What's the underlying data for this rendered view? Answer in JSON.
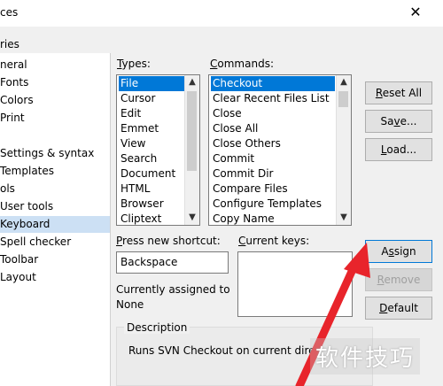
{
  "window": {
    "title": "ces",
    "close_glyph": "✕"
  },
  "categories": {
    "label": "ries",
    "items": [
      {
        "label": "neral"
      },
      {
        "label": "Fonts"
      },
      {
        "label": "Colors"
      },
      {
        "label": "Print"
      },
      {
        "label": ""
      },
      {
        "label": "Settings & syntax"
      },
      {
        "label": "Templates"
      },
      {
        "label": "ols"
      },
      {
        "label": "User tools"
      },
      {
        "label": "Keyboard",
        "selected": true
      },
      {
        "label": "Spell checker"
      },
      {
        "label": "Toolbar"
      },
      {
        "label": "Layout"
      }
    ]
  },
  "types": {
    "label_u": "T",
    "label_rest": "ypes:",
    "items": [
      "File",
      "Cursor",
      "Edit",
      "Emmet",
      "View",
      "Search",
      "Document",
      "HTML",
      "Browser",
      "Cliptext"
    ],
    "selected": "File"
  },
  "commands": {
    "label_u": "C",
    "label_rest": "ommands:",
    "items": [
      "Checkout",
      "Clear Recent Files List",
      "Close",
      "Close All",
      "Close Others",
      "Commit",
      "Commit Dir",
      "Compare Files",
      "Configure Templates",
      "Copy Name"
    ],
    "selected": "Checkout"
  },
  "buttons": {
    "reset_all_u": "R",
    "reset_all_rest": "eset All",
    "save_pre": "Sa",
    "save_u": "v",
    "save_rest": "e...",
    "load_u": "L",
    "load_rest": "oad...",
    "assign_pre": "A",
    "assign_u": "s",
    "assign_rest": "sign",
    "remove_u": "R",
    "remove_rest": "emove",
    "default_u": "D",
    "default_rest": "efault"
  },
  "shortcut": {
    "label_u": "P",
    "label_rest": "ress new shortcut:",
    "value": "Backspace",
    "current_keys_u": "C",
    "current_keys_rest": "urrent keys:",
    "assigned_label": "Currently assigned to",
    "assigned_value": "None"
  },
  "description": {
    "label": "Description",
    "text": "Runs SVN Checkout on current dire"
  },
  "watermark": "软件技巧",
  "colors": {
    "arrow": "#e8242b",
    "selection": "#0078d7"
  }
}
